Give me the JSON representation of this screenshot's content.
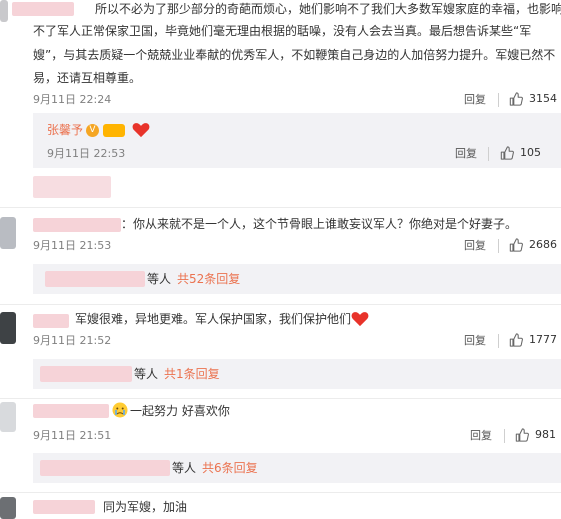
{
  "comments": [
    {
      "text_lines": [
        "所以不必为了那少部分的奇葩而烦心，她们影响不了我们大多数军嫂家庭的幸福，也影响",
        "不了军人正常保家卫国，毕竟她们毫无理由根据的聒噪，没有人会去当真。最后想告诉某些“军",
        "嫂”，与其去质疑一个兢兢业业奉献的优秀军人，不如鞭策自己身边的人加倍努力提升。军嫂已然不",
        "易，还请互相尊重。"
      ],
      "time": "9月11日 22:24",
      "reply_label": "回复",
      "likes": "3154"
    },
    {
      "nested_author": "张馨予",
      "nested_badges": [
        "verified-v-badge",
        "member-badge",
        "heart-emoji"
      ],
      "time": "9月11日 22:53",
      "reply_label": "回复",
      "likes": "105"
    },
    {
      "text": "：你从来就不是一个人，这个节骨眼上谁敢妄议军人？你绝对是个好妻子。",
      "time": "9月11日 21:53",
      "reply_label": "回复",
      "likes": "2686",
      "replies_prefix": "等人",
      "replies_link": "共52条回复"
    },
    {
      "text": "军嫂很难，异地更难。军人保护国家，我们保护他们",
      "time": "9月11日 21:52",
      "reply_label": "回复",
      "likes": "1777",
      "replies_prefix": "等人",
      "replies_link": "共1条回复"
    },
    {
      "text": "一起努力 好喜欢你",
      "time": "9月11日 21:51",
      "reply_label": "回复",
      "likes": "981",
      "replies_prefix": "等人",
      "replies_link": "共6条回复"
    },
    {
      "text": "同为军嫂，加油"
    }
  ],
  "colors": {
    "link": "#eb7350",
    "blur_pink": "#f6d3d8",
    "sub_bg": "#f2f2f5"
  }
}
